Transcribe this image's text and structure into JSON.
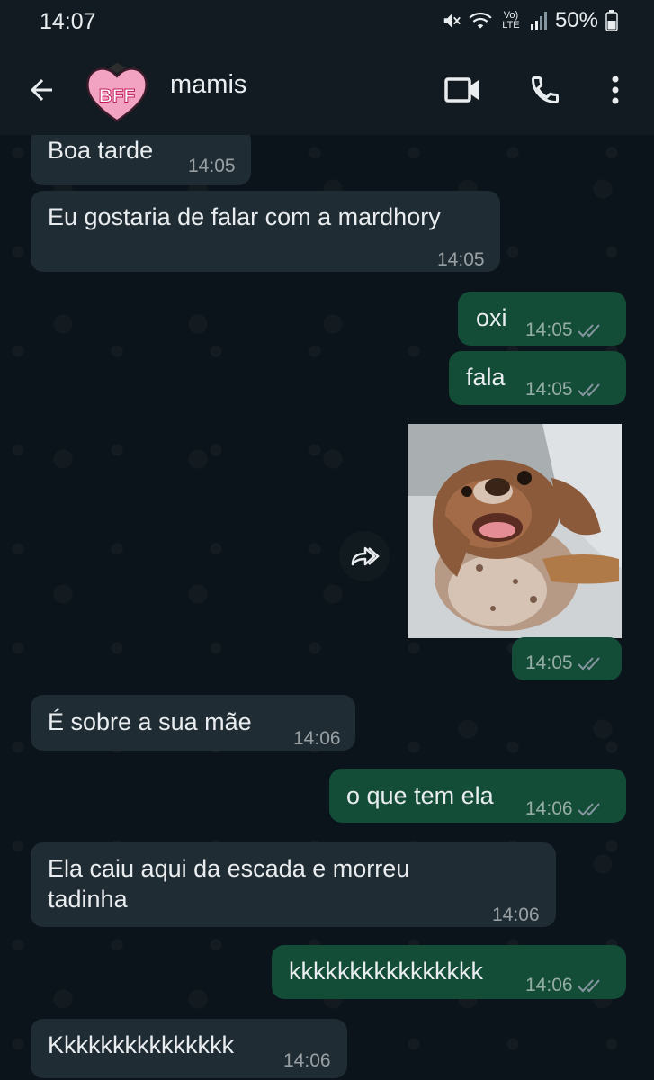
{
  "status_bar": {
    "time": "14:07",
    "battery": "50%",
    "network": "Vo) LTE",
    "icons": [
      "mute-icon",
      "wifi-icon",
      "volte-icon",
      "signal-icon",
      "battery-icon"
    ]
  },
  "header": {
    "contact_name": "mamis",
    "avatar_text": "BFF",
    "icons": [
      "back-arrow-icon",
      "video-call-icon",
      "phone-icon",
      "more-vert-icon"
    ]
  },
  "messages": [
    {
      "direction": "in",
      "text": "Boa tarde",
      "time": "14:05"
    },
    {
      "direction": "in",
      "text": "Eu gostaria de falar com a mardhory",
      "time": "14:05"
    },
    {
      "direction": "out",
      "text": "oxi",
      "time": "14:05",
      "status": "read"
    },
    {
      "direction": "out",
      "text": "fala",
      "time": "14:05",
      "status": "read"
    },
    {
      "direction": "out",
      "type": "image",
      "time": "14:05",
      "status": "read"
    },
    {
      "direction": "in",
      "text": "É sobre a sua mãe",
      "time": "14:06"
    },
    {
      "direction": "out",
      "text": "o que tem ela",
      "time": "14:06",
      "status": "read"
    },
    {
      "direction": "in",
      "text": "Ela caiu aqui da escada e morreu tadinha",
      "time": "14:06"
    },
    {
      "direction": "out",
      "text": "kkkkkkkkkkkkkkkk",
      "time": "14:06",
      "status": "read"
    },
    {
      "direction": "in",
      "text": "Kkkkkkkkkkkkkkk",
      "time": "14:06"
    }
  ],
  "colors": {
    "background": "#0b141a",
    "header": "#111b21",
    "incoming_bubble": "#202c33",
    "outgoing_bubble": "#144d37",
    "read_ticks": "#8696a0"
  }
}
